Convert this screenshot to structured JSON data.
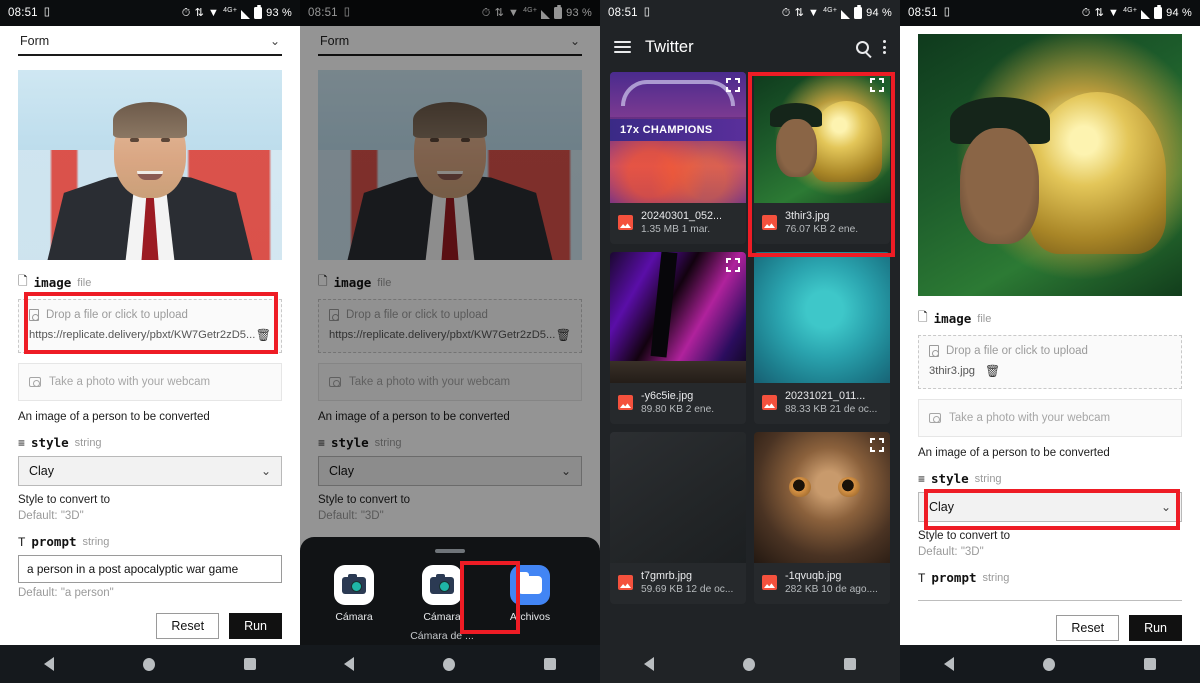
{
  "status_bars": [
    {
      "time": "08:51",
      "battery": "93 %",
      "network": "4G+"
    },
    {
      "time": "08:51",
      "battery": "93 %",
      "network": "4G+"
    },
    {
      "time": "08:51",
      "battery": "94 %",
      "network": "4G+"
    },
    {
      "time": "08:51",
      "battery": "94 %",
      "network": "4G+"
    }
  ],
  "colors": {
    "highlight": "#ee1c25",
    "accent_blue": "#4285f4",
    "file_icon": "#f4513d",
    "files_bg": "#202326",
    "run_button": "#111111"
  },
  "panel1": {
    "form_select": "Form",
    "image_field": {
      "name": "image",
      "type": "file",
      "drop_label": "Drop a file or click to upload",
      "value": "https://replicate.delivery/pbxt/KW7Getr2zD5...",
      "webcam_label": "Take a photo with your webcam",
      "helper": "An image of a person to be converted"
    },
    "style_field": {
      "name": "style",
      "type": "string",
      "value": "Clay",
      "helper": "Style to convert to",
      "default": "Default: \"3D\""
    },
    "prompt_field": {
      "name": "prompt",
      "type": "string",
      "value": "a person in a post apocalyptic war game",
      "default": "Default: \"a person\""
    },
    "reset_label": "Reset",
    "run_label": "Run"
  },
  "panel2": {
    "form_select": "Form",
    "image_field": {
      "name": "image",
      "type": "file",
      "drop_label": "Drop a file or click to upload",
      "value": "https://replicate.delivery/pbxt/KW7Getr2zD5...",
      "webcam_label": "Take a photo with your webcam",
      "helper": "An image of a person to be converted"
    },
    "style_field": {
      "name": "style",
      "type": "string",
      "value": "Clay",
      "helper": "Style to convert to",
      "default": "Default: \"3D\""
    },
    "sheet_apps": [
      {
        "label": "Cámara",
        "sub": "",
        "icon": "camera-icon"
      },
      {
        "label": "Cámara",
        "sub": "Cámara de ...",
        "icon": "camera-icon"
      },
      {
        "label": "Archivos",
        "sub": "",
        "icon": "folder-icon"
      }
    ]
  },
  "panel3": {
    "title": "Twitter",
    "files": [
      {
        "name": "20240301_052...",
        "meta": "1.35 MB 1 mar.",
        "thumb": "lakers",
        "expand": true
      },
      {
        "name": "3thir3.jpg",
        "meta": "76.07 KB 2 ene.",
        "thumb": "trophy",
        "expand": true
      },
      {
        "name": "-y6c5ie.jpg",
        "meta": "89.80 KB 2 ene.",
        "thumb": "neon",
        "expand": true
      },
      {
        "name": "20231021_011...",
        "meta": "88.33 KB 21 de oc...",
        "thumb": "teal",
        "expand": false
      },
      {
        "name": "t7gmrb.jpg",
        "meta": "59.69 KB 12 de oc...",
        "thumb": "dark",
        "expand": false
      },
      {
        "name": "-1qvuqb.jpg",
        "meta": "282 KB 10 de ago....",
        "thumb": "owl",
        "expand": true
      }
    ]
  },
  "panel4": {
    "image_field": {
      "name": "image",
      "type": "file",
      "drop_label": "Drop a file or click to upload",
      "value": "3thir3.jpg",
      "webcam_label": "Take a photo with your webcam",
      "helper": "An image of a person to be converted"
    },
    "style_field": {
      "name": "style",
      "type": "string",
      "value": "Clay",
      "helper": "Style to convert to",
      "default": "Default: \"3D\""
    },
    "prompt_field": {
      "name": "prompt",
      "type": "string",
      "value": ""
    },
    "reset_label": "Reset",
    "run_label": "Run"
  },
  "icons": {
    "alarm": "⏰",
    "vibrate": "📳",
    "wifi": "▼",
    "menu": "hamburger-icon",
    "search": "search-icon",
    "overflow": "kebab-icon",
    "trash": "🗑",
    "chevron_down": "⌄",
    "file_type": "file-icon",
    "list": "≡",
    "text": "T"
  }
}
